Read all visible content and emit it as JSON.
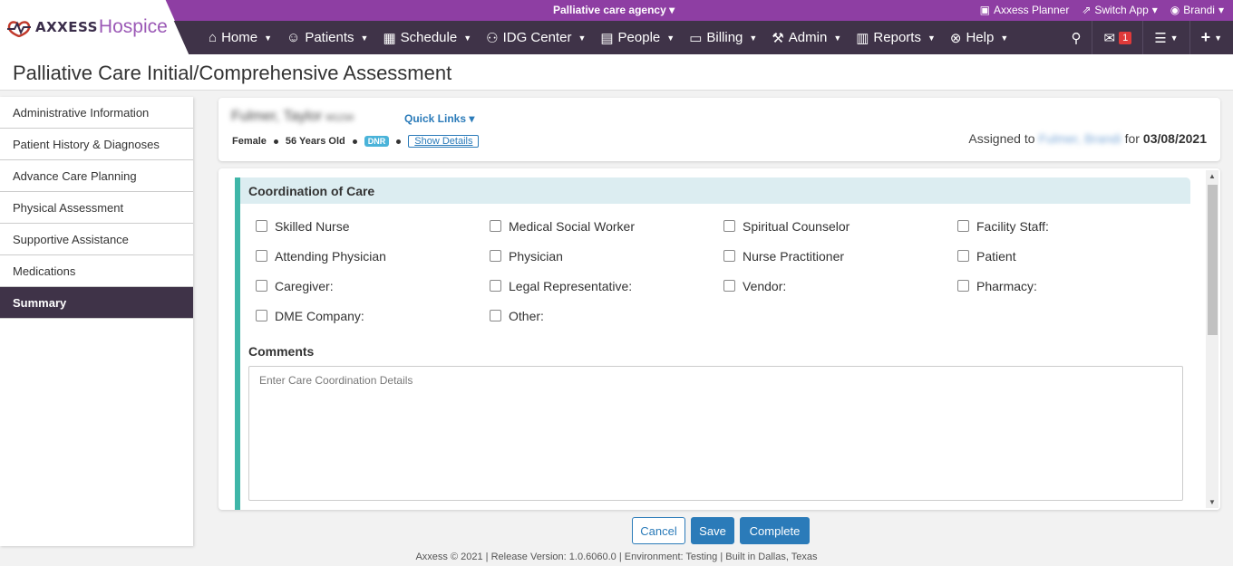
{
  "brand": {
    "name_bold": "AXXESS",
    "name_light": "Hospice"
  },
  "topbar": {
    "agency": "Palliative care agency",
    "planner": "Axxess Planner",
    "switch_app": "Switch App",
    "user": "Brandi"
  },
  "nav": {
    "items": [
      {
        "label": "Home"
      },
      {
        "label": "Patients"
      },
      {
        "label": "Schedule"
      },
      {
        "label": "IDG Center"
      },
      {
        "label": "People"
      },
      {
        "label": "Billing"
      },
      {
        "label": "Admin"
      },
      {
        "label": "Reports"
      },
      {
        "label": "Help"
      }
    ],
    "message_count": "1"
  },
  "page": {
    "title": "Palliative Care Initial/Comprehensive Assessment"
  },
  "sidebar": {
    "items": [
      {
        "label": "Administrative Information"
      },
      {
        "label": "Patient History & Diagnoses"
      },
      {
        "label": "Advance Care Planning"
      },
      {
        "label": "Physical Assessment"
      },
      {
        "label": "Supportive Assistance"
      },
      {
        "label": "Medications"
      },
      {
        "label": "Summary"
      }
    ],
    "active_index": 6
  },
  "patient": {
    "name": "Fulmer, Taylor",
    "mrn": "M1234",
    "quick_links": "Quick Links",
    "gender": "Female",
    "age": "56 Years Old",
    "dnr": "DNR",
    "show_details": "Show Details",
    "assigned_prefix": "Assigned to",
    "assigned_to": "Fulmer, Brandi",
    "assigned_for": "for",
    "date": "03/08/2021"
  },
  "section": {
    "title": "Coordination of Care",
    "checkboxes": [
      "Skilled Nurse",
      "Medical Social Worker",
      "Spiritual Counselor",
      "Facility Staff:",
      "Attending Physician",
      "Physician",
      "Nurse Practitioner",
      "Patient",
      "Caregiver:",
      "Legal Representative:",
      "Vendor:",
      "Pharmacy:",
      "DME Company:",
      "Other:"
    ],
    "comments_label": "Comments",
    "comments_placeholder": "Enter Care Coordination Details"
  },
  "buttons": {
    "cancel": "Cancel",
    "save": "Save",
    "complete": "Complete"
  },
  "footer": "Axxess © 2021 | Release Version: 1.0.6060.0 | Environment: Testing | Built in Dallas, Texas"
}
